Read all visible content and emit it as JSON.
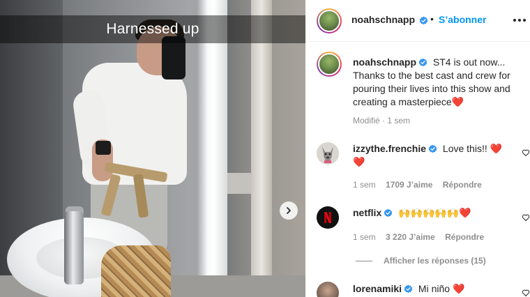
{
  "photo": {
    "caption": "Harnessed up",
    "next_icon": "chevron-right-icon"
  },
  "post": {
    "author": "noahschnapp",
    "follow_label": "S’abonner",
    "separator": "•",
    "caption_text": "ST4 is out now... Thanks to the best cast and crew for pouring their lives into this show and creating a masterpiece",
    "caption_emoji": "❤️",
    "edited_label": "Modifié",
    "meta_sep": " · ",
    "time": "1 sem"
  },
  "comments": [
    {
      "author": "izzythe.frenchie",
      "text": "Love this!! ❤️",
      "text_wrap": "❤️",
      "time": "1 sem",
      "likes": "1709 J’aime",
      "reply_label": "Répondre"
    },
    {
      "author": "netflix",
      "text": "🙌🙌🙌🙌🙌❤️",
      "time": "1 sem",
      "likes": "3 220 J’aime",
      "reply_label": "Répondre"
    },
    {
      "author": "lorenamiki",
      "text": "Mi niño ❤️"
    }
  ],
  "show_replies": "Afficher les réponses (15)",
  "colors": {
    "accent_blue": "#0095f6",
    "verified_blue": "#3897f0",
    "netflix_red": "#e50914",
    "text": "#262626",
    "muted": "#8e8e8e"
  }
}
